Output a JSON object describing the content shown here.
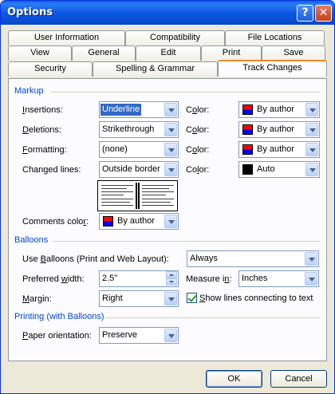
{
  "window": {
    "title": "Options",
    "help_glyph": "?",
    "close_glyph": "✕"
  },
  "tabs": {
    "row1": [
      "User Information",
      "Compatibility",
      "File Locations"
    ],
    "row2": [
      "View",
      "General",
      "Edit",
      "Print",
      "Save"
    ],
    "row3": [
      "Security",
      "Spelling & Grammar",
      "Track Changes"
    ],
    "active": "Track Changes"
  },
  "markup": {
    "title": "Markup",
    "insertions": {
      "label_u": "I",
      "label_rest": "nsertions:",
      "value": "Underline",
      "color_label_pre": "C",
      "color_label_u": "o",
      "color_label_post": "lor:",
      "color": "By author"
    },
    "deletions": {
      "label_u": "D",
      "label_rest": "eletions:",
      "value": "Strikethrough",
      "color_label_pre": "C",
      "color_label_u": "o",
      "color_label_post": "lor:",
      "color": "By author"
    },
    "formatting": {
      "label_u": "F",
      "label_rest": "ormatting:",
      "value": "(none)",
      "color_label_pre": "C",
      "color_label_u": "o",
      "color_label_post": "lor:",
      "color": "By author"
    },
    "changed_lines": {
      "label_pre": "Chan",
      "label_u": "g",
      "label_rest": "ed lines:",
      "value": "Outside border",
      "color_label_pre": "Co",
      "color_label_u": "l",
      "color_label_post": "or:",
      "color": "Auto"
    },
    "comments_color": {
      "label_pre": "Comments colo",
      "label_u": "r",
      "label_rest": ":",
      "value": "By author"
    }
  },
  "balloons": {
    "title": "Balloons",
    "use_balloons": {
      "label_pre": "Use ",
      "label_u": "B",
      "label_rest": "alloons (Print and Web Layout):",
      "value": "Always"
    },
    "preferred_width": {
      "label_pre": "Preferred ",
      "label_u": "w",
      "label_rest": "idth:",
      "value": "2.5\""
    },
    "measure_in": {
      "label_pre": "Measure i",
      "label_u": "n",
      "label_rest": ":",
      "value": "Inches"
    },
    "margin": {
      "label_u": "M",
      "label_rest": "argin:",
      "value": "Right"
    },
    "show_lines": {
      "label_u": "S",
      "label_rest": "how lines connecting to text",
      "checked": true
    }
  },
  "printing": {
    "title": "Printing (with Balloons)",
    "paper_orientation": {
      "label_u": "P",
      "label_rest": "aper orientation:",
      "value": "Preserve"
    }
  },
  "buttons": {
    "ok": "OK",
    "cancel": "Cancel"
  },
  "colors": {
    "title_bar": "#0b56e0",
    "section_title": "#0046d5",
    "active_tab_accent": "#e68b2c",
    "selection": "#316ac5"
  }
}
